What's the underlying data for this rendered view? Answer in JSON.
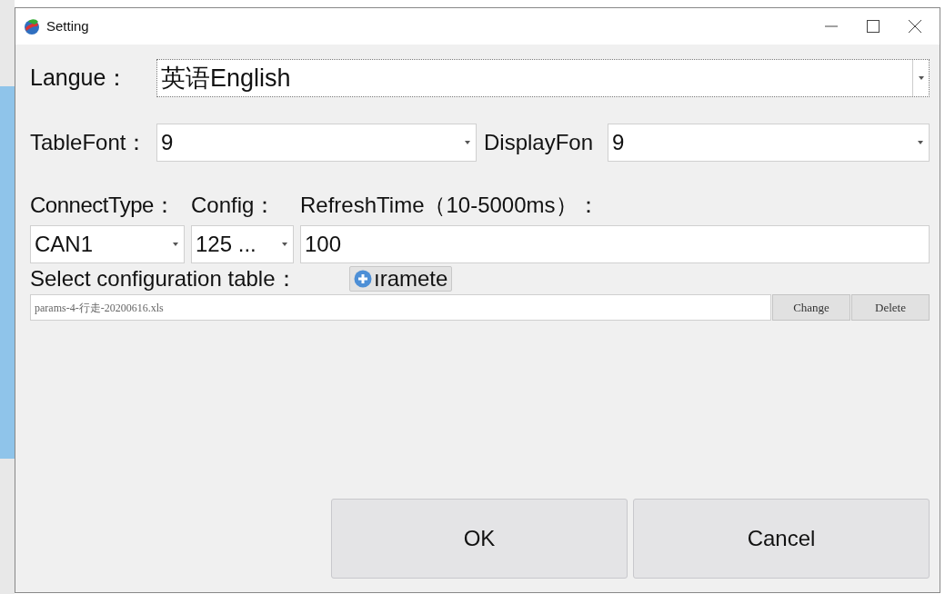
{
  "window": {
    "title": "Setting"
  },
  "language": {
    "label": "Langue：",
    "value": "英语English",
    "focused": true
  },
  "table_font": {
    "label": "TableFont：",
    "value": "9"
  },
  "display_font": {
    "label": "DisplayFon",
    "value": "9"
  },
  "connect_type": {
    "label": "ConnectType：",
    "value": "CAN1"
  },
  "config": {
    "label": "Config：",
    "value": "125 ..."
  },
  "refresh_time": {
    "label": "RefreshTime（10-5000ms）：",
    "value": "100"
  },
  "config_table": {
    "label": "Select configuration table：",
    "add_button": "ıramete",
    "file": "params-4-行走-20200616.xls",
    "buttons": [
      "Change",
      "Delete"
    ]
  },
  "buttons": [
    "OK",
    "Cancel"
  ]
}
